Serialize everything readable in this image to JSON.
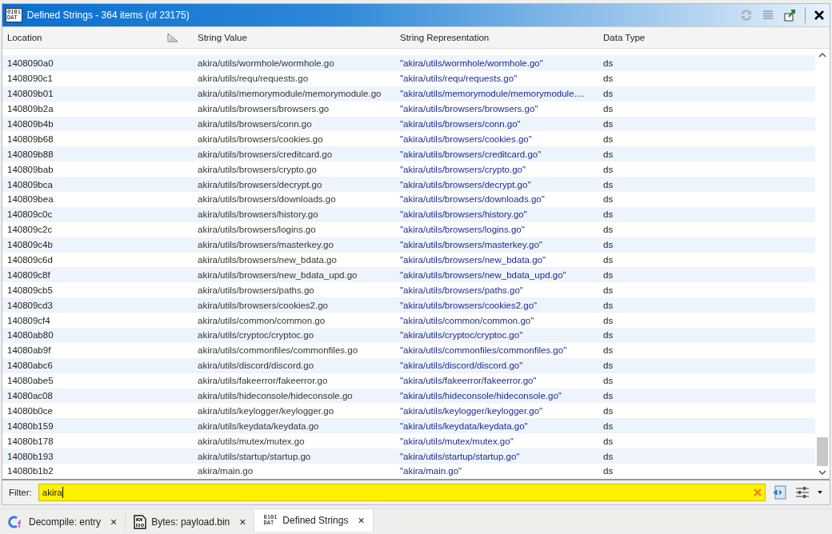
{
  "window": {
    "title": "Defined Strings - 364 items (of 23175)",
    "icon_text": [
      "0101",
      "DAT"
    ]
  },
  "table": {
    "columns": [
      "Location",
      "String Value",
      "String Representation",
      "Data Type"
    ],
    "rows": [
      {
        "location": "1408090a0",
        "value": "akira/utils/wormhole/wormhole.go",
        "representation": "\"akira/utils/wormhole/wormhole.go\"",
        "data_type": "ds"
      },
      {
        "location": "1408090c1",
        "value": "akira/utils/requ/requests.go",
        "representation": "\"akira/utils/requ/requests.go\"",
        "data_type": "ds"
      },
      {
        "location": "140809b01",
        "value": "akira/utils/memorymodule/memorymodule.go",
        "representation": "\"akira/utils/memorymodule/memorymodule....",
        "data_type": "ds"
      },
      {
        "location": "140809b2a",
        "value": "akira/utils/browsers/browsers.go",
        "representation": "\"akira/utils/browsers/browsers.go\"",
        "data_type": "ds"
      },
      {
        "location": "140809b4b",
        "value": "akira/utils/browsers/conn.go",
        "representation": "\"akira/utils/browsers/conn.go\"",
        "data_type": "ds"
      },
      {
        "location": "140809b68",
        "value": "akira/utils/browsers/cookies.go",
        "representation": "\"akira/utils/browsers/cookies.go\"",
        "data_type": "ds"
      },
      {
        "location": "140809b88",
        "value": "akira/utils/browsers/creditcard.go",
        "representation": "\"akira/utils/browsers/creditcard.go\"",
        "data_type": "ds"
      },
      {
        "location": "140809bab",
        "value": "akira/utils/browsers/crypto.go",
        "representation": "\"akira/utils/browsers/crypto.go\"",
        "data_type": "ds"
      },
      {
        "location": "140809bca",
        "value": "akira/utils/browsers/decrypt.go",
        "representation": "\"akira/utils/browsers/decrypt.go\"",
        "data_type": "ds"
      },
      {
        "location": "140809bea",
        "value": "akira/utils/browsers/downloads.go",
        "representation": "\"akira/utils/browsers/downloads.go\"",
        "data_type": "ds"
      },
      {
        "location": "140809c0c",
        "value": "akira/utils/browsers/history.go",
        "representation": "\"akira/utils/browsers/history.go\"",
        "data_type": "ds"
      },
      {
        "location": "140809c2c",
        "value": "akira/utils/browsers/logins.go",
        "representation": "\"akira/utils/browsers/logins.go\"",
        "data_type": "ds"
      },
      {
        "location": "140809c4b",
        "value": "akira/utils/browsers/masterkey.go",
        "representation": "\"akira/utils/browsers/masterkey.go\"",
        "data_type": "ds"
      },
      {
        "location": "140809c6d",
        "value": "akira/utils/browsers/new_bdata.go",
        "representation": "\"akira/utils/browsers/new_bdata.go\"",
        "data_type": "ds"
      },
      {
        "location": "140809c8f",
        "value": "akira/utils/browsers/new_bdata_upd.go",
        "representation": "\"akira/utils/browsers/new_bdata_upd.go\"",
        "data_type": "ds"
      },
      {
        "location": "140809cb5",
        "value": "akira/utils/browsers/paths.go",
        "representation": "\"akira/utils/browsers/paths.go\"",
        "data_type": "ds"
      },
      {
        "location": "140809cd3",
        "value": "akira/utils/browsers/cookies2.go",
        "representation": "\"akira/utils/browsers/cookies2.go\"",
        "data_type": "ds"
      },
      {
        "location": "140809cf4",
        "value": "akira/utils/common/common.go",
        "representation": "\"akira/utils/common/common.go\"",
        "data_type": "ds"
      },
      {
        "location": "14080ab80",
        "value": "akira/utils/cryptoc/cryptoc.go",
        "representation": "\"akira/utils/cryptoc/cryptoc.go\"",
        "data_type": "ds"
      },
      {
        "location": "14080ab9f",
        "value": "akira/utils/commonfiles/commonfiles.go",
        "representation": "\"akira/utils/commonfiles/commonfiles.go\"",
        "data_type": "ds"
      },
      {
        "location": "14080abc6",
        "value": "akira/utils/discord/discord.go",
        "representation": "\"akira/utils/discord/discord.go\"",
        "data_type": "ds"
      },
      {
        "location": "14080abe5",
        "value": "akira/utils/fakeerror/fakeerror.go",
        "representation": "\"akira/utils/fakeerror/fakeerror.go\"",
        "data_type": "ds"
      },
      {
        "location": "14080ac08",
        "value": "akira/utils/hideconsole/hideconsole.go",
        "representation": "\"akira/utils/hideconsole/hideconsole.go\"",
        "data_type": "ds"
      },
      {
        "location": "14080b0ce",
        "value": "akira/utils/keylogger/keylogger.go",
        "representation": "\"akira/utils/keylogger/keylogger.go\"",
        "data_type": "ds"
      },
      {
        "location": "14080b159",
        "value": "akira/utils/keydata/keydata.go",
        "representation": "\"akira/utils/keydata/keydata.go\"",
        "data_type": "ds"
      },
      {
        "location": "14080b178",
        "value": "akira/utils/mutex/mutex.go",
        "representation": "\"akira/utils/mutex/mutex.go\"",
        "data_type": "ds"
      },
      {
        "location": "14080b193",
        "value": "akira/utils/startup/startup.go",
        "representation": "\"akira/utils/startup/startup.go\"",
        "data_type": "ds"
      },
      {
        "location": "14080b1b2",
        "value": "akira/main.go",
        "representation": "\"akira/main.go\"",
        "data_type": "ds"
      }
    ]
  },
  "filter": {
    "label": "Filter:",
    "value": "akira"
  },
  "tabs": [
    {
      "kind": "decompile",
      "label": "Decompile: entry",
      "close": "×",
      "selected": false
    },
    {
      "kind": "bytes",
      "label": "Bytes: payload.bin",
      "close": "×",
      "selected": false
    },
    {
      "kind": "strings",
      "label": "Defined Strings",
      "close": "×",
      "selected": true,
      "icon_text": [
        "0101",
        "DAT"
      ]
    }
  ]
}
